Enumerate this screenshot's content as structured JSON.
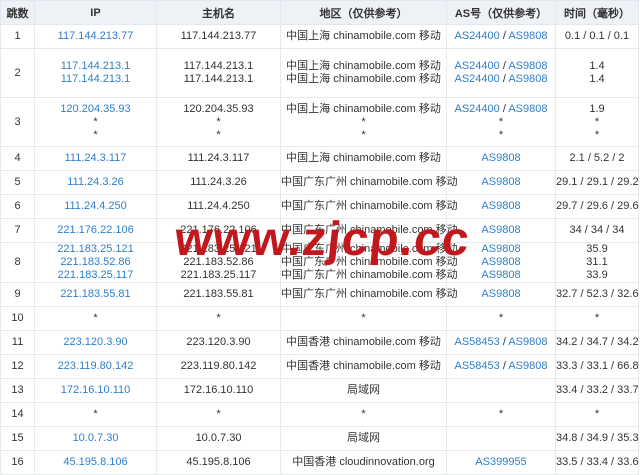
{
  "headers": {
    "hop": "跳数",
    "ip": "IP",
    "host": "主机名",
    "region": "地区（仅供参考）",
    "as": "AS号（仅供参考）",
    "time": "时间（毫秒）"
  },
  "watermark": "www.zjcp.cc",
  "colors": {
    "link": "#2f7fca",
    "header_bg": "#eef1f6",
    "border": "#e6e9ef",
    "watermark": "#c2181d"
  },
  "rows": [
    {
      "hop": "1",
      "ips": [
        "117.144.213.77"
      ],
      "hosts": [
        "117.144.213.77"
      ],
      "regions": [
        "中国上海 chinamobile.com 移动"
      ],
      "as": [
        [
          "AS24400",
          "AS9808"
        ]
      ],
      "times": [
        "0.1 / 0.1 / 0.1"
      ]
    },
    {
      "hop": "2",
      "ips": [
        "117.144.213.1",
        "117.144.213.1"
      ],
      "hosts": [
        "117.144.213.1",
        "117.144.213.1"
      ],
      "regions": [
        "中国上海 chinamobile.com 移动",
        "中国上海 chinamobile.com 移动"
      ],
      "as": [
        [
          "AS24400",
          "AS9808"
        ],
        [
          "AS24400",
          "AS9808"
        ]
      ],
      "times": [
        "1.4",
        "1.4"
      ]
    },
    {
      "hop": "3",
      "ips": [
        "120.204.35.93",
        "*",
        "*"
      ],
      "hosts": [
        "120.204.35.93",
        "*",
        "*"
      ],
      "regions": [
        "中国上海 chinamobile.com 移动",
        "*",
        "*"
      ],
      "as": [
        [
          "AS24400",
          "AS9808"
        ],
        [
          "*"
        ],
        [
          "*"
        ]
      ],
      "times": [
        "1.9",
        "*",
        "*"
      ]
    },
    {
      "hop": "4",
      "ips": [
        "111.24.3.117"
      ],
      "hosts": [
        "111.24.3.117"
      ],
      "regions": [
        "中国上海 chinamobile.com 移动"
      ],
      "as": [
        [
          "AS9808"
        ]
      ],
      "times": [
        "2.1 / 5.2 / 2"
      ]
    },
    {
      "hop": "5",
      "ips": [
        "111.24.3.26"
      ],
      "hosts": [
        "111.24.3.26"
      ],
      "regions": [
        "中国广东广州 chinamobile.com 移动"
      ],
      "as": [
        [
          "AS9808"
        ]
      ],
      "times": [
        "29.1 / 29.1 / 29.2"
      ]
    },
    {
      "hop": "6",
      "ips": [
        "111.24.4.250"
      ],
      "hosts": [
        "111.24.4.250"
      ],
      "regions": [
        "中国广东广州 chinamobile.com 移动"
      ],
      "as": [
        [
          "AS9808"
        ]
      ],
      "times": [
        "29.7 / 29.6 / 29.6"
      ]
    },
    {
      "hop": "7",
      "ips": [
        "221.176.22.106"
      ],
      "hosts": [
        "221.176.22.106"
      ],
      "regions": [
        "中国广东广州 chinamobile.com 移动"
      ],
      "as": [
        [
          "AS9808"
        ]
      ],
      "times": [
        "34 / 34 / 34"
      ]
    },
    {
      "hop": "8",
      "ips": [
        "221.183.25.121",
        "221.183.52.86",
        "221.183.25.117"
      ],
      "hosts": [
        "221.183.25.121",
        "221.183.52.86",
        "221.183.25.117"
      ],
      "regions": [
        "中国广东广州 chinamobile.com 移动",
        "中国广东广州 chinamobile.com 移动",
        "中国广东广州 chinamobile.com 移动"
      ],
      "as": [
        [
          "AS9808"
        ],
        [
          "AS9808"
        ],
        [
          "AS9808"
        ]
      ],
      "times": [
        "35.9",
        "31.1",
        "33.9"
      ]
    },
    {
      "hop": "9",
      "ips": [
        "221.183.55.81"
      ],
      "hosts": [
        "221.183.55.81"
      ],
      "regions": [
        "中国广东广州 chinamobile.com 移动"
      ],
      "as": [
        [
          "AS9808"
        ]
      ],
      "times": [
        "32.7 / 52.3 / 32.6"
      ]
    },
    {
      "hop": "10",
      "ips": [
        "*"
      ],
      "hosts": [
        "*"
      ],
      "regions": [
        "*"
      ],
      "as": [
        [
          "*"
        ]
      ],
      "times": [
        "*"
      ]
    },
    {
      "hop": "11",
      "ips": [
        "223.120.3.90"
      ],
      "hosts": [
        "223.120.3.90"
      ],
      "regions": [
        "中国香港 chinamobile.com 移动"
      ],
      "as": [
        [
          "AS58453",
          "AS9808"
        ]
      ],
      "times": [
        "34.2 / 34.7 / 34.2"
      ]
    },
    {
      "hop": "12",
      "ips": [
        "223.119.80.142"
      ],
      "hosts": [
        "223.119.80.142"
      ],
      "regions": [
        "中国香港 chinamobile.com 移动"
      ],
      "as": [
        [
          "AS58453",
          "AS9808"
        ]
      ],
      "times": [
        "33.3 / 33.1 / 66.8"
      ]
    },
    {
      "hop": "13",
      "ips": [
        "172.16.10.110"
      ],
      "hosts": [
        "172.16.10.110"
      ],
      "regions": [
        "局域网"
      ],
      "as": [
        []
      ],
      "times": [
        "33.4 / 33.2 / 33.7"
      ]
    },
    {
      "hop": "14",
      "ips": [
        "*"
      ],
      "hosts": [
        "*"
      ],
      "regions": [
        "*"
      ],
      "as": [
        [
          "*"
        ]
      ],
      "times": [
        "*"
      ]
    },
    {
      "hop": "15",
      "ips": [
        "10.0.7.30"
      ],
      "hosts": [
        "10.0.7.30"
      ],
      "regions": [
        "局域网"
      ],
      "as": [
        []
      ],
      "times": [
        "34.8 / 34.9 / 35.3"
      ]
    },
    {
      "hop": "16",
      "ips": [
        "45.195.8.106"
      ],
      "hosts": [
        "45.195.8.106"
      ],
      "regions": [
        "中国香港 cloudinnovation.org"
      ],
      "as": [
        [
          "AS399955"
        ]
      ],
      "times": [
        "33.5 / 33.4 / 33.6"
      ]
    }
  ]
}
